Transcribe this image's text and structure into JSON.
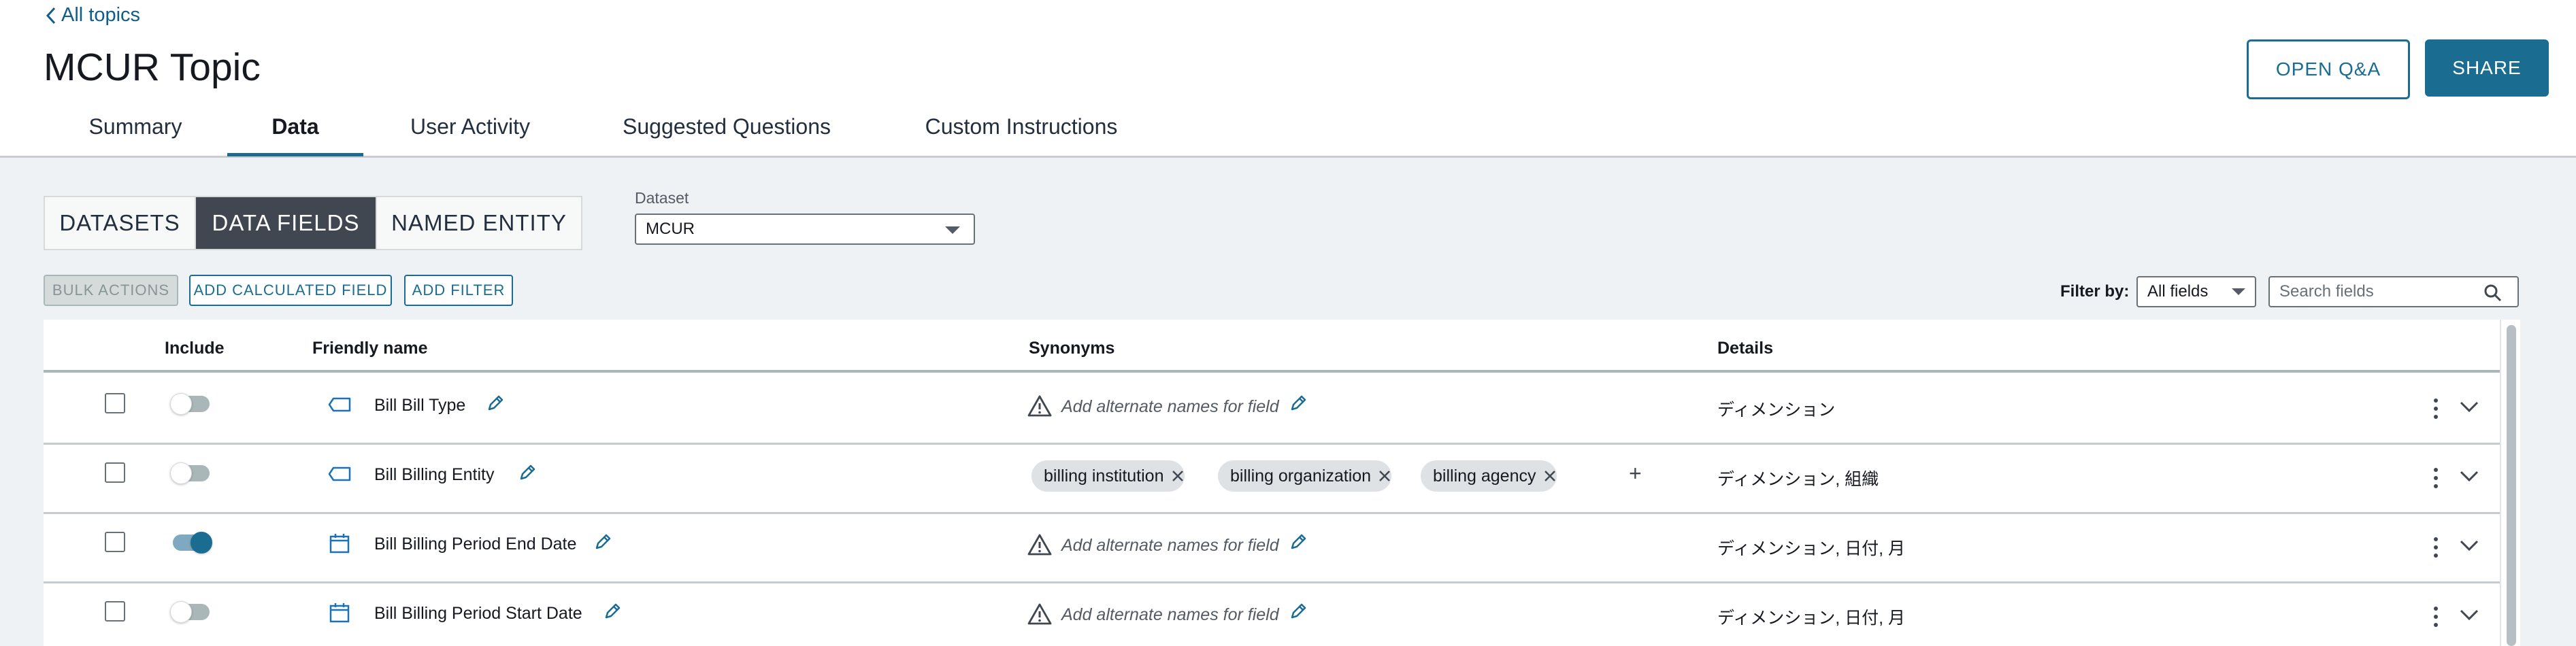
{
  "header": {
    "back_link": "All topics",
    "title": "MCUR Topic",
    "open_qa_label": "OPEN Q&A",
    "share_label": "SHARE",
    "tabs": [
      {
        "label": "Summary",
        "active": false
      },
      {
        "label": "Data",
        "active": true
      },
      {
        "label": "User Activity",
        "active": false
      },
      {
        "label": "Suggested Questions",
        "active": false
      },
      {
        "label": "Custom Instructions",
        "active": false
      }
    ]
  },
  "segments": [
    {
      "label": "DATASETS",
      "active": false
    },
    {
      "label": "DATA FIELDS",
      "active": true
    },
    {
      "label": "NAMED ENTITY",
      "active": false
    }
  ],
  "dataset": {
    "label": "Dataset",
    "value": "MCUR"
  },
  "actions": {
    "bulk_actions": "BULK ACTIONS",
    "add_calculated_field": "ADD CALCULATED FIELD",
    "add_filter": "ADD FILTER"
  },
  "filter": {
    "label": "Filter by:",
    "value": "All fields",
    "search_placeholder": "Search fields"
  },
  "table": {
    "columns": {
      "include": "Include",
      "friendly_name": "Friendly name",
      "synonyms": "Synonyms",
      "details": "Details"
    },
    "rows": [
      {
        "name": "Bill Bill Type",
        "type_icon": "tag-icon",
        "included": false,
        "synonyms_placeholder": "Add alternate names for field",
        "synonyms": [],
        "details": "ディメンション"
      },
      {
        "name": "Bill Billing Entity",
        "type_icon": "tag-icon",
        "included": false,
        "synonyms_placeholder": "",
        "synonyms": [
          "billing institution",
          "billing organization",
          "billing agency"
        ],
        "details": "ディメンション, 組織"
      },
      {
        "name": "Bill Billing Period End Date",
        "type_icon": "calendar-icon",
        "included": true,
        "synonyms_placeholder": "Add alternate names for field",
        "synonyms": [],
        "details": "ディメンション, 日付, 月"
      },
      {
        "name": "Bill Billing Period Start Date",
        "type_icon": "calendar-icon",
        "included": false,
        "synonyms_placeholder": "Add alternate names for field",
        "synonyms": [],
        "details": "ディメンション, 日付, 月"
      }
    ],
    "add_synonym_symbol": "+"
  },
  "colors": {
    "accent": "#1a6d91",
    "link": "#0f5e8a",
    "content_bg": "#eef2f5",
    "segment_active": "#414750",
    "chip_bg": "#dfe2e5"
  }
}
